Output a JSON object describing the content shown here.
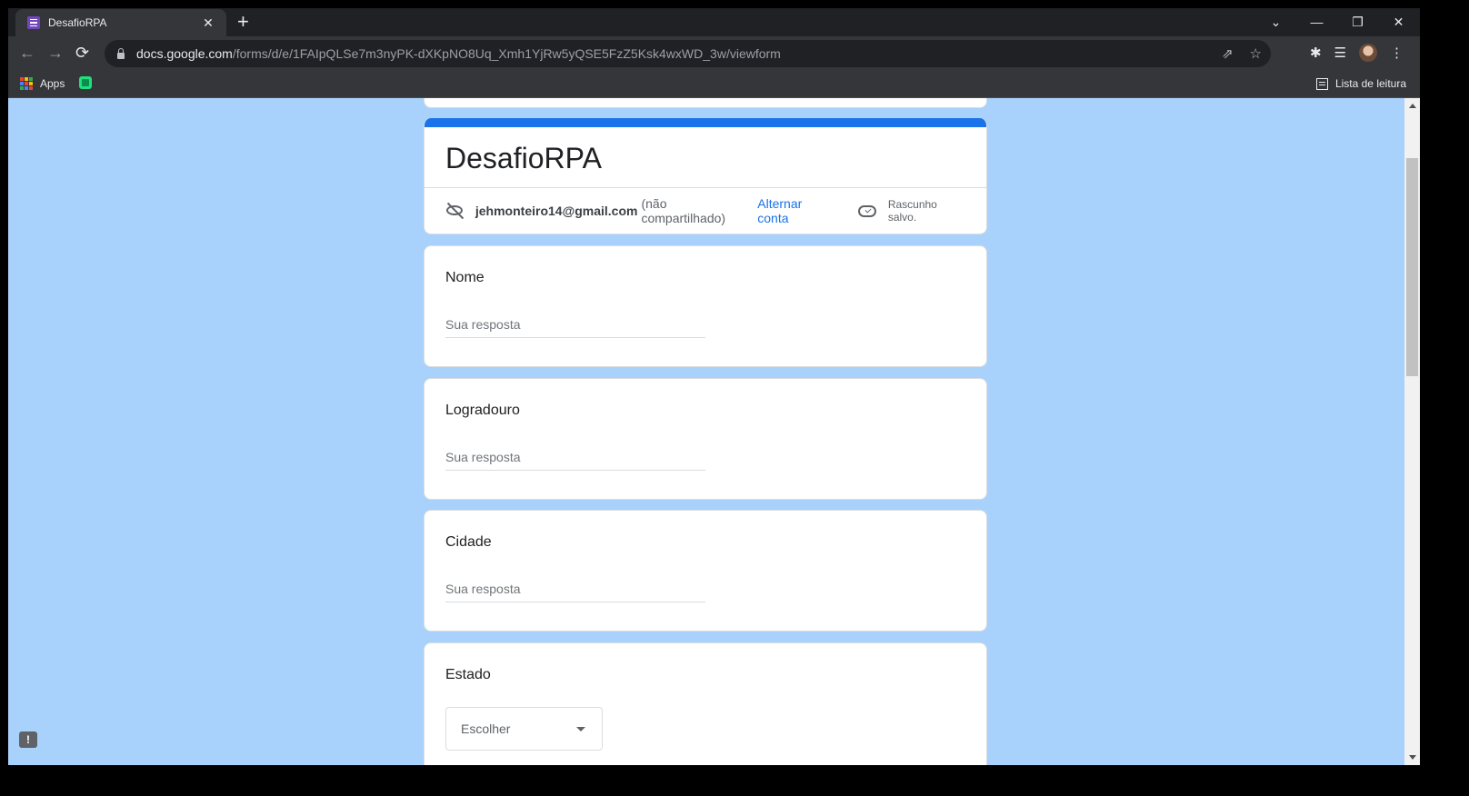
{
  "browser": {
    "tab_title": "DesafioRPA",
    "tab_close": "✕",
    "new_tab": "+",
    "window_controls": [
      "⌄",
      "—",
      "❐",
      "✕"
    ],
    "url_host": "docs.google.com",
    "url_path": "/forms/d/e/1FAIpQLSe7m3nyPK-dXKpNO8Uq_Xmh1YjRw5yQSE5FzZ5Ksk4wxWD_3w/viewform",
    "icons": [
      "back-icon",
      "forward-icon",
      "reload-icon",
      "share-icon",
      "star-icon",
      "extensions-icon",
      "media-icon",
      "menu-icon"
    ],
    "nav": {
      "back": "←",
      "forward": "→",
      "reload": "⟳"
    },
    "omni_icons": {
      "share": "⇗",
      "star": "☆"
    },
    "toolbar_glyphs": {
      "extensions": "✱",
      "media": "☰",
      "menu": "⋮"
    }
  },
  "bookmarks": {
    "apps_label": "Apps",
    "apps_colors": [
      "#ea4335",
      "#fbbc04",
      "#34a853",
      "#4285f4",
      "#ea4335",
      "#fbbc04",
      "#34a853",
      "#4285f4",
      "#ea4335"
    ],
    "reading_list": "Lista de leitura"
  },
  "form": {
    "title": "DesafioRPA",
    "email": "jehmonteiro14@gmail.com",
    "not_shared": "(não compartilhado)",
    "switch_account": "Alternar conta",
    "draft_status": "Rascunho salvo.",
    "accent_color": "#1a73e8",
    "background_color": "#a8d1fb",
    "questions": [
      {
        "label": "Nome",
        "placeholder": "Sua resposta"
      },
      {
        "label": "Logradouro",
        "placeholder": "Sua resposta"
      },
      {
        "label": "Cidade",
        "placeholder": "Sua resposta"
      }
    ],
    "select_question": {
      "label": "Estado",
      "value": "Escolher"
    }
  },
  "feedback_glyph": "!"
}
